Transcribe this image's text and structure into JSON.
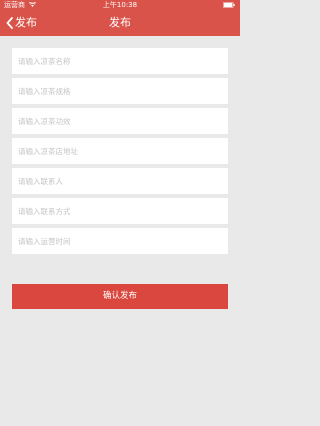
{
  "status_bar": {
    "carrier": "运营商",
    "time": "上午10:38",
    "wifi_icon": "wifi-icon",
    "battery_icon": "battery-icon"
  },
  "nav": {
    "back_label": "发布",
    "back_icon": "chevron-left-icon",
    "title": "发布"
  },
  "form": {
    "fields": [
      {
        "placeholder": "请输入凉茶名称",
        "value": ""
      },
      {
        "placeholder": "请输入凉茶规格",
        "value": ""
      },
      {
        "placeholder": "请输入凉茶功效",
        "value": ""
      },
      {
        "placeholder": "请输入凉茶店地址",
        "value": ""
      },
      {
        "placeholder": "请输入联系人",
        "value": ""
      },
      {
        "placeholder": "请输入联系方式",
        "value": ""
      },
      {
        "placeholder": "请输入运营时间",
        "value": ""
      }
    ],
    "submit_label": "确认发布"
  },
  "colors": {
    "header": "#d9534a",
    "button": "#d9473e",
    "background": "#e9e9e9"
  }
}
